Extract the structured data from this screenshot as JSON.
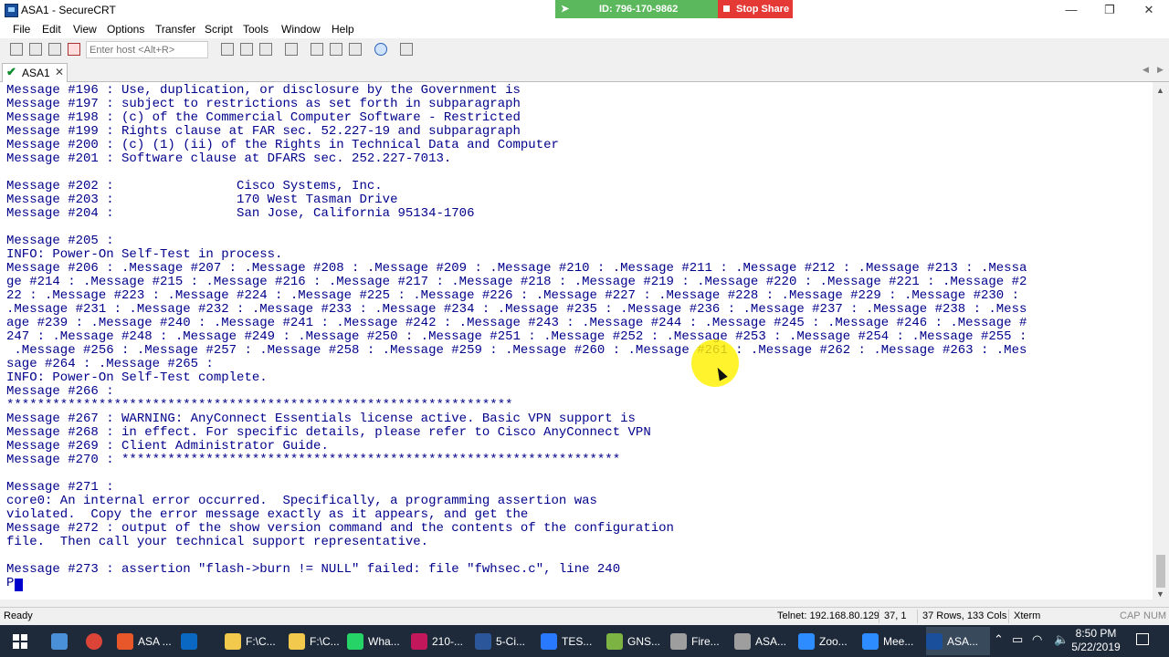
{
  "window": {
    "title": "ASA1 - SecureCRT",
    "minimize": "—",
    "restore": "❐",
    "close": "✕"
  },
  "share": {
    "id_label": "ID: 796-170-9862",
    "stop_label": "Stop Share",
    "color_id": "#5cb85c",
    "color_stop": "#e53935"
  },
  "menu": [
    "File",
    "Edit",
    "View",
    "Options",
    "Transfer",
    "Script",
    "Tools",
    "Window",
    "Help"
  ],
  "toolbar": {
    "host_placeholder": "Enter host <Alt+R>"
  },
  "tab": {
    "label": "ASA1",
    "check": "✔",
    "close": "✕"
  },
  "terminal": {
    "text_color": "#00008b",
    "lines": [
      "Message #196 : Use, duplication, or disclosure by the Government is",
      "Message #197 : subject to restrictions as set forth in subparagraph",
      "Message #198 : (c) of the Commercial Computer Software - Restricted",
      "Message #199 : Rights clause at FAR sec. 52.227-19 and subparagraph",
      "Message #200 : (c) (1) (ii) of the Rights in Technical Data and Computer",
      "Message #201 : Software clause at DFARS sec. 252.227-7013.",
      "",
      "Message #202 :                Cisco Systems, Inc.",
      "Message #203 :                170 West Tasman Drive",
      "Message #204 :                San Jose, California 95134-1706",
      "",
      "Message #205 :",
      "INFO: Power-On Self-Test in process.",
      "Message #206 : .Message #207 : .Message #208 : .Message #209 : .Message #210 : .Message #211 : .Message #212 : .Message #213 : .Messa",
      "ge #214 : .Message #215 : .Message #216 : .Message #217 : .Message #218 : .Message #219 : .Message #220 : .Message #221 : .Message #2",
      "22 : .Message #223 : .Message #224 : .Message #225 : .Message #226 : .Message #227 : .Message #228 : .Message #229 : .Message #230 :",
      ".Message #231 : .Message #232 : .Message #233 : .Message #234 : .Message #235 : .Message #236 : .Message #237 : .Message #238 : .Mess",
      "age #239 : .Message #240 : .Message #241 : .Message #242 : .Message #243 : .Message #244 : .Message #245 : .Message #246 : .Message #",
      "247 : .Message #248 : .Message #249 : .Message #250 : .Message #251 : .Message #252 : .Message #253 : .Message #254 : .Message #255 :",
      " .Message #256 : .Message #257 : .Message #258 : .Message #259 : .Message #260 : .Message #261 : .Message #262 : .Message #263 : .Mes",
      "sage #264 : .Message #265 :",
      "INFO: Power-On Self-Test complete.",
      "Message #266 :",
      "******************************************************************",
      "Message #267 : WARNING: AnyConnect Essentials license active. Basic VPN support is",
      "Message #268 : in effect. For specific details, please refer to Cisco AnyConnect VPN",
      "Message #269 : Client Administrator Guide.",
      "Message #270 : *****************************************************************",
      "",
      "Message #271 :",
      "core0: An internal error occurred.  Specifically, a programming assertion was",
      "violated.  Copy the error message exactly as it appears, and get the",
      "Message #272 : output of the show version command and the contents of the configuration",
      "file.  Then call your technical support representative.",
      "",
      "Message #273 : assertion \"flash->burn != NULL\" failed: file \"fwhsec.c\", line 240",
      "P"
    ]
  },
  "status": {
    "ready": "Ready",
    "telnet": "Telnet: 192.168.80.129",
    "position": "37,  1",
    "size": "37 Rows, 133 Cols",
    "terminal_type": "Xterm",
    "caps": "CAP",
    "num": "NUM"
  },
  "taskbar": {
    "items": [
      {
        "label": "ASA ...",
        "color": "#e8572a"
      },
      {
        "label": "",
        "color": "#0a68c2"
      },
      {
        "label": "F:\\C...",
        "color": "#f2c94c"
      },
      {
        "label": "F:\\C...",
        "color": "#f2c94c"
      },
      {
        "label": "Wha...",
        "color": "#25d366"
      },
      {
        "label": "210-...",
        "color": "#c2185b"
      },
      {
        "label": "5-Ci...",
        "color": "#2b579a"
      },
      {
        "label": "TES...",
        "color": "#2979ff"
      },
      {
        "label": "GNS...",
        "color": "#7cb342"
      },
      {
        "label": "Fire...",
        "color": "#9e9e9e"
      },
      {
        "label": "ASA...",
        "color": "#9e9e9e"
      },
      {
        "label": "Zoo...",
        "color": "#2d8cff"
      },
      {
        "label": "Mee...",
        "color": "#2d8cff"
      },
      {
        "label": "ASA...",
        "color": "#1a4f9c"
      }
    ],
    "time": "8:50 PM",
    "date": "5/22/2019"
  }
}
